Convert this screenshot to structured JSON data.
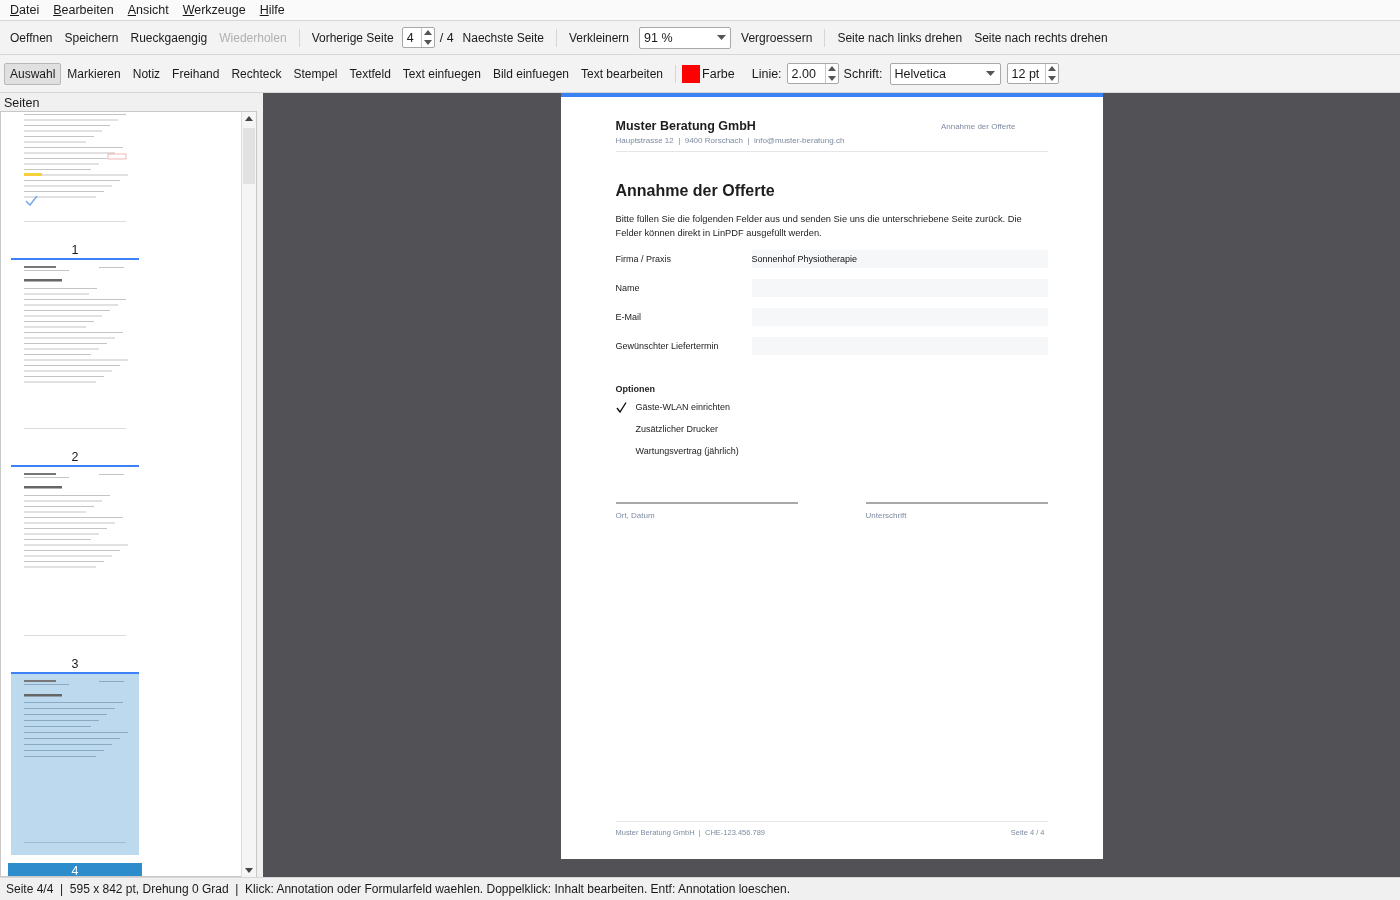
{
  "menu": [
    "Datei",
    "Bearbeiten",
    "Ansicht",
    "Werkzeuge",
    "Hilfe"
  ],
  "toolbar": [
    {
      "kind": "button",
      "label": "Oeffnen",
      "disabled": false
    },
    {
      "kind": "button",
      "label": "Speichern",
      "disabled": false
    },
    {
      "kind": "button",
      "label": "Rueckgaengig",
      "disabled": false
    },
    {
      "kind": "button",
      "label": "Wiederholen",
      "disabled": true
    },
    {
      "kind": "separator"
    },
    {
      "kind": "button",
      "label": "Vorherige Seite",
      "disabled": false
    },
    {
      "kind": "spin",
      "value": "4"
    },
    {
      "kind": "text",
      "label": "/ 4"
    },
    {
      "kind": "button",
      "label": "Naechste Seite",
      "disabled": false
    },
    {
      "kind": "separator"
    },
    {
      "kind": "button",
      "label": "Verkleinern",
      "disabled": false
    },
    {
      "kind": "combo",
      "value": "91 %"
    },
    {
      "kind": "button",
      "label": "Vergroessern",
      "disabled": false
    },
    {
      "kind": "separator"
    },
    {
      "kind": "button",
      "label": "Seite nach links drehen",
      "disabled": false
    },
    {
      "kind": "button",
      "label": "Seite nach rechts drehen",
      "disabled": false
    }
  ],
  "tools": [
    {
      "kind": "tool",
      "label": "Auswahl",
      "selected": true
    },
    {
      "kind": "tool",
      "label": "Markieren",
      "selected": false
    },
    {
      "kind": "tool",
      "label": "Notiz",
      "selected": false
    },
    {
      "kind": "tool",
      "label": "Freihand",
      "selected": false
    },
    {
      "kind": "tool",
      "label": "Rechteck",
      "selected": false
    },
    {
      "kind": "tool",
      "label": "Stempel",
      "selected": false
    },
    {
      "kind": "tool",
      "label": "Textfeld",
      "selected": false
    },
    {
      "kind": "tool",
      "label": "Text einfuegen",
      "selected": false
    },
    {
      "kind": "tool",
      "label": "Bild einfuegen",
      "selected": false
    },
    {
      "kind": "tool",
      "label": "Text bearbeiten",
      "selected": false
    },
    {
      "kind": "separator"
    },
    {
      "kind": "color",
      "label": "Farbe",
      "color": "#ff0000"
    },
    {
      "kind": "text",
      "label": "Linie:"
    },
    {
      "kind": "spin",
      "value": "2.00"
    },
    {
      "kind": "text",
      "label": "Schrift:"
    },
    {
      "kind": "combo",
      "value": "Helvetica"
    },
    {
      "kind": "spin",
      "value": "12 pt"
    }
  ],
  "sidebar": {
    "title": "Seiten",
    "pages": [
      {
        "label": "1",
        "selected": false
      },
      {
        "label": "2",
        "selected": false
      },
      {
        "label": "3",
        "selected": false
      },
      {
        "label": "4",
        "selected": true
      }
    ]
  },
  "document": {
    "company": "Muster Beratung GmbH",
    "address": "Hauptstrasse 12  |  9400 Rorschach  |  info@muster-beratung.ch",
    "header_right": "Annahme der Offerte",
    "title": "Annahme der Offerte",
    "intro": "Bitte füllen Sie die folgenden Felder aus und senden Sie uns die unterschriebene Seite zurück. Die Felder können direkt in LinPDF ausgefüllt werden.",
    "fields": [
      {
        "label": "Firma / Praxis",
        "value": "Sonnenhof Physiotherapie"
      },
      {
        "label": "Name"
      },
      {
        "label": "E-Mail"
      },
      {
        "label": "Gewünschter Liefertermin"
      }
    ],
    "options_title": "Optionen",
    "options": [
      {
        "label": "Gäste-WLAN einrichten",
        "checked": true
      },
      {
        "label": "Zusätzlicher Drucker",
        "checked": false
      },
      {
        "label": "Wartungsvertrag (jährlich)",
        "checked": false
      }
    ],
    "signatures": [
      "Ort, Datum",
      "Unterschrift"
    ],
    "footer_left": "Muster Beratung GmbH  |  CHE-123.456.789",
    "footer_right": "Seite 4 / 4"
  },
  "status_bar": "Seite 4/4  |  595 x 842 pt, Drehung 0 Grad  |  Klick: Annotation oder Formularfeld waehlen. Doppelklick: Inhalt bearbeiten. Entf: Annotation loeschen."
}
